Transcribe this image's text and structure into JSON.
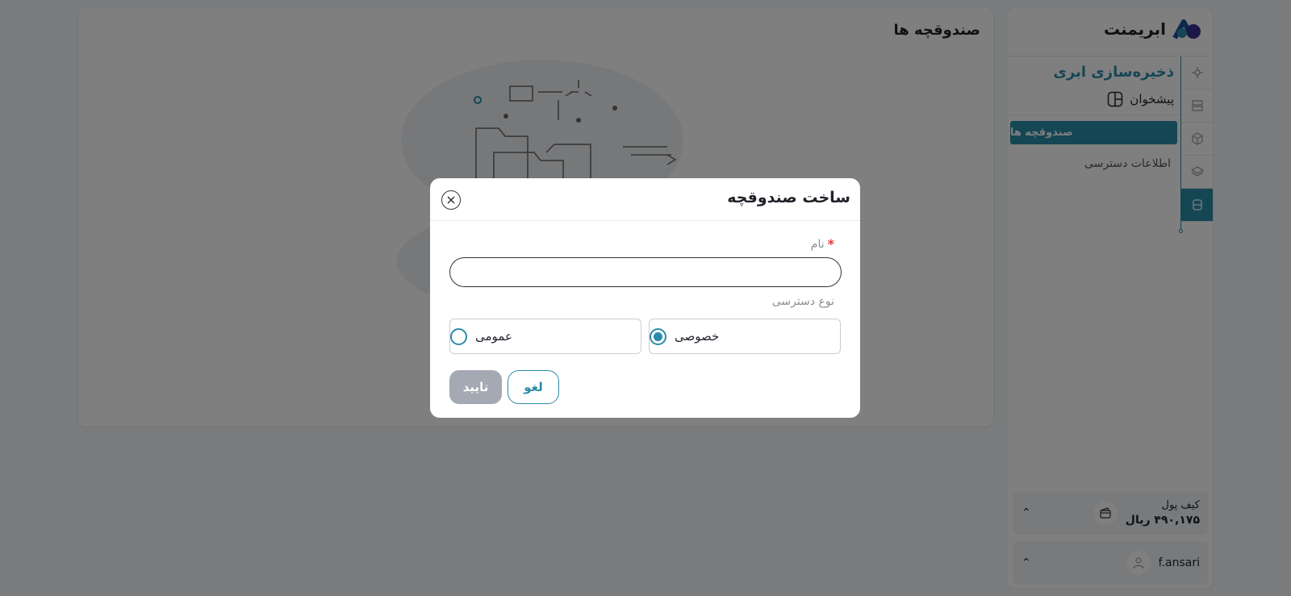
{
  "brand": {
    "name": "ابریمنت",
    "accent": "#2a8ca8"
  },
  "main": {
    "title": "صندوقچه ها"
  },
  "sidebar": {
    "section_title": "ذخیره‌سازی ابری",
    "dashboard_label": "پیشخوان",
    "items": [
      {
        "label": "صندوقچه ها",
        "active": true
      },
      {
        "label": "اطلاعات دسترسی",
        "active": false
      }
    ],
    "rail_icons": [
      "network-icon",
      "server-icon",
      "cube-icon",
      "layers-icon",
      "storage-icon"
    ],
    "wallet": {
      "label": "کیف پول",
      "amount": "۴۹۰,۱۷۵ ریال"
    },
    "user": {
      "name": "f.ansari"
    }
  },
  "modal": {
    "title": "ساخت صندوقچه",
    "name_label": "نام",
    "required_mark": "*",
    "name_value": "",
    "access_label": "نوع دسترسی",
    "options": [
      {
        "label": "خصوصی",
        "selected": true
      },
      {
        "label": "عمومی",
        "selected": false
      }
    ],
    "cancel_label": "لغو",
    "confirm_label": "تایید"
  }
}
